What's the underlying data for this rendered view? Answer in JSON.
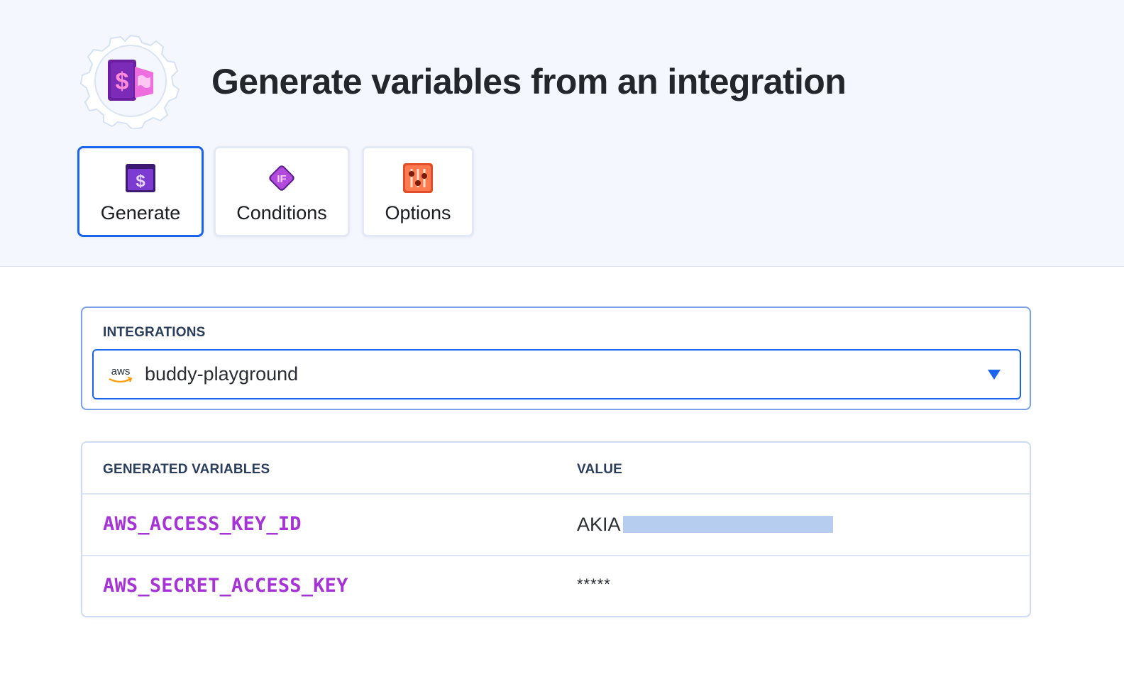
{
  "header": {
    "title": "Generate variables from an integration",
    "logo_icon": "action-gear-dollar-icon"
  },
  "tabs": [
    {
      "label": "Generate",
      "icon": "dollar-window-icon",
      "active": true
    },
    {
      "label": "Conditions",
      "icon": "if-diamond-icon",
      "active": false
    },
    {
      "label": "Options",
      "icon": "sliders-icon",
      "active": false
    }
  ],
  "integrations": {
    "label": "INTEGRATIONS",
    "selected": "buddy-playground",
    "provider_logo": "aws"
  },
  "variables_table": {
    "columns": [
      "GENERATED VARIABLES",
      "VALUE"
    ],
    "rows": [
      {
        "name": "AWS_ACCESS_KEY_ID",
        "value": "AKIA"
      },
      {
        "name": "AWS_SECRET_ACCESS_KEY",
        "value": "*****"
      }
    ]
  },
  "colors": {
    "accent": "#1a64f0",
    "variable_name": "#a633d6",
    "header_bg": "#f4f7fd",
    "redaction": "#b7cdef"
  }
}
